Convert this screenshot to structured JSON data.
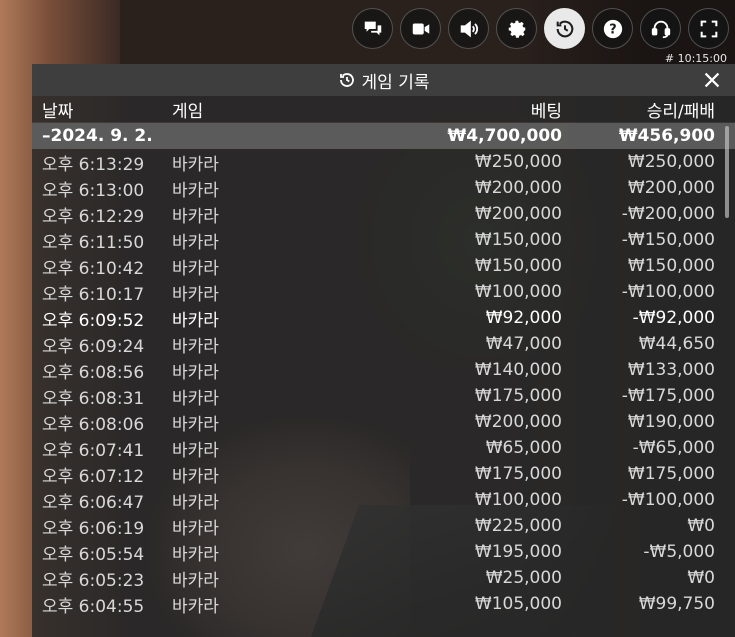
{
  "toolbar": {
    "buttons": [
      {
        "name": "chat-icon"
      },
      {
        "name": "video-icon"
      },
      {
        "name": "volume-icon"
      },
      {
        "name": "gear-icon"
      },
      {
        "name": "history-icon",
        "active": true
      },
      {
        "name": "help-icon"
      },
      {
        "name": "support-headset-icon"
      },
      {
        "name": "fullscreen-icon"
      }
    ],
    "timecode": "# 10:15:00"
  },
  "panel": {
    "title": "게임 기록",
    "columns": {
      "date": "날짜",
      "game": "게임",
      "bet": "베팅",
      "winloss": "승리/패배"
    },
    "group": {
      "date": "–2024. 9. 2.",
      "bet": "₩4,700,000",
      "winloss": "₩456,900"
    },
    "rows": [
      {
        "time": "오후 6:13:29",
        "game": "바카라",
        "bet": "₩250,000",
        "winloss": "₩250,000"
      },
      {
        "time": "오후 6:13:00",
        "game": "바카라",
        "bet": "₩200,000",
        "winloss": "₩200,000"
      },
      {
        "time": "오후 6:12:29",
        "game": "바카라",
        "bet": "₩200,000",
        "winloss": "-₩200,000"
      },
      {
        "time": "오후 6:11:50",
        "game": "바카라",
        "bet": "₩150,000",
        "winloss": "-₩150,000"
      },
      {
        "time": "오후 6:10:42",
        "game": "바카라",
        "bet": "₩150,000",
        "winloss": "₩150,000"
      },
      {
        "time": "오후 6:10:17",
        "game": "바카라",
        "bet": "₩100,000",
        "winloss": "-₩100,000"
      },
      {
        "time": "오후 6:09:52",
        "game": "바카라",
        "bet": "₩92,000",
        "winloss": "-₩92,000",
        "highlight": true
      },
      {
        "time": "오후 6:09:24",
        "game": "바카라",
        "bet": "₩47,000",
        "winloss": "₩44,650"
      },
      {
        "time": "오후 6:08:56",
        "game": "바카라",
        "bet": "₩140,000",
        "winloss": "₩133,000"
      },
      {
        "time": "오후 6:08:31",
        "game": "바카라",
        "bet": "₩175,000",
        "winloss": "-₩175,000"
      },
      {
        "time": "오후 6:08:06",
        "game": "바카라",
        "bet": "₩200,000",
        "winloss": "₩190,000"
      },
      {
        "time": "오후 6:07:41",
        "game": "바카라",
        "bet": "₩65,000",
        "winloss": "-₩65,000"
      },
      {
        "time": "오후 6:07:12",
        "game": "바카라",
        "bet": "₩175,000",
        "winloss": "₩175,000"
      },
      {
        "time": "오후 6:06:47",
        "game": "바카라",
        "bet": "₩100,000",
        "winloss": "-₩100,000"
      },
      {
        "time": "오후 6:06:19",
        "game": "바카라",
        "bet": "₩225,000",
        "winloss": "₩0"
      },
      {
        "time": "오후 6:05:54",
        "game": "바카라",
        "bet": "₩195,000",
        "winloss": "-₩5,000"
      },
      {
        "time": "오후 6:05:23",
        "game": "바카라",
        "bet": "₩25,000",
        "winloss": "₩0"
      },
      {
        "time": "오후 6:04:55",
        "game": "바카라",
        "bet": "₩105,000",
        "winloss": "₩99,750"
      }
    ]
  }
}
